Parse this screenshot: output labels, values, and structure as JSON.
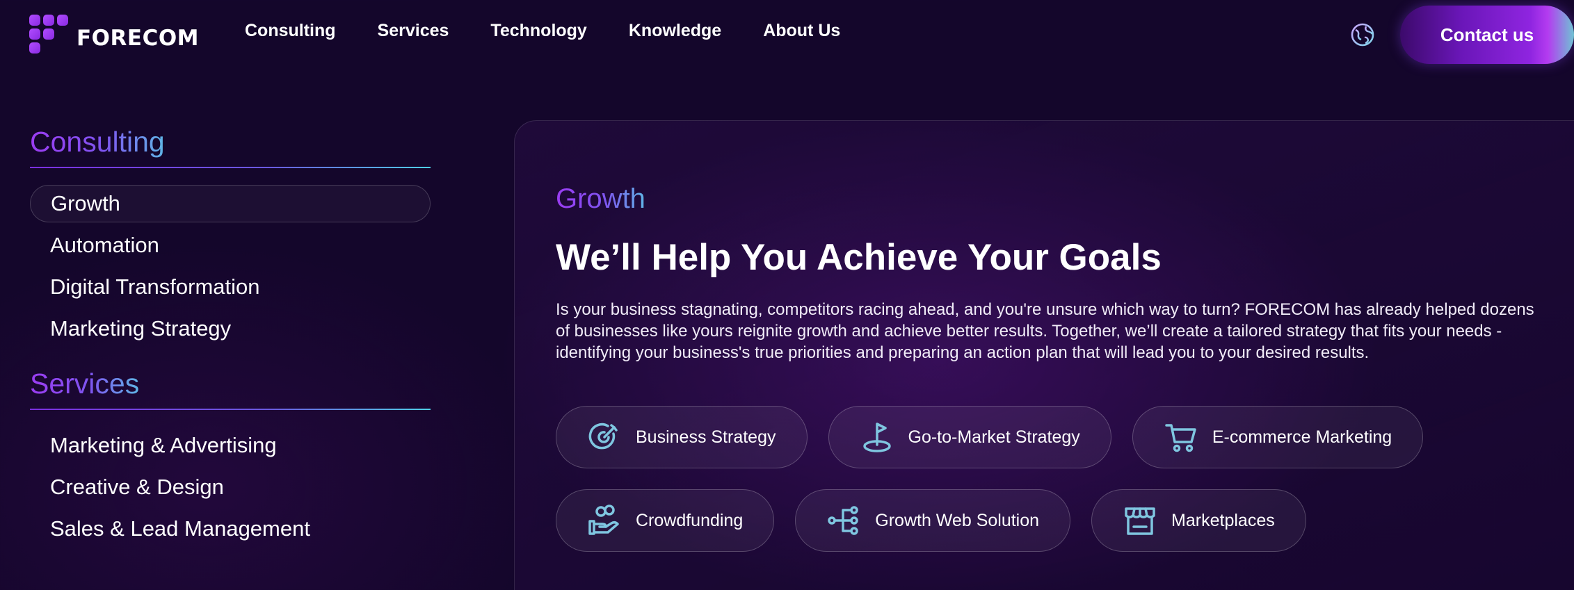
{
  "header": {
    "logo_text": "FORECOM",
    "nav": [
      "Consulting",
      "Services",
      "Technology",
      "Knowledge",
      "About Us"
    ],
    "contact_label": "Contact us",
    "language_icon": "globe-icon"
  },
  "sidebar": {
    "sections": [
      {
        "title": "Consulting",
        "items": [
          "Growth",
          "Automation",
          "Digital Transformation",
          "Marketing Strategy"
        ]
      },
      {
        "title": "Services",
        "items": [
          "Marketing & Advertising",
          "Creative & Design",
          "Sales & Lead Management"
        ]
      }
    ],
    "active_item": "Growth"
  },
  "content": {
    "eyebrow": "Growth",
    "heading": "We’ll Help You Achieve Your Goals",
    "description": "Is your business stagnating, competitors racing ahead, and you're unsure which way to turn? FORECOM has already helped dozens of businesses like yours reignite growth and achieve better results. Together, we’ll create a tailored strategy that fits your needs - identifying your business's true priorities and preparing an action plan that will lead you to your desired results.",
    "chips": [
      {
        "label": "Business Strategy",
        "icon": "target-icon"
      },
      {
        "label": "Go-to-Market Strategy",
        "icon": "flag-pin-icon"
      },
      {
        "label": "E-commerce Marketing",
        "icon": "cart-icon"
      },
      {
        "label": "Crowdfunding",
        "icon": "hand-coins-icon"
      },
      {
        "label": "Growth Web Solution",
        "icon": "network-icon"
      },
      {
        "label": "Marketplaces",
        "icon": "storefront-icon"
      }
    ]
  },
  "colors": {
    "background": "#14062b",
    "accent_purple": "#9b3cf2",
    "accent_cyan": "#5fb6e6",
    "icon_stroke": "#7fc6e0"
  }
}
